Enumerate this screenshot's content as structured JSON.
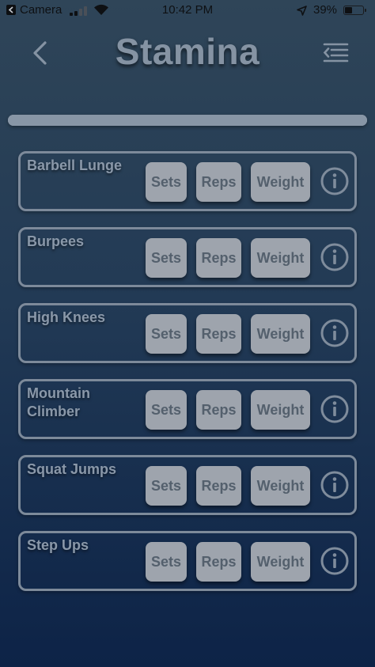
{
  "status_bar": {
    "carrier": "Camera",
    "time": "10:42 PM",
    "battery_percent": "39%",
    "battery_level": 0.39
  },
  "header": {
    "title": "Stamina",
    "back_icon": "chevron-left-icon",
    "menu_icon": "menu-list-icon"
  },
  "progress": {
    "value": 1.0
  },
  "exercises": [
    {
      "name": "Barbell Lunge",
      "sets_label": "Sets",
      "reps_label": "Reps",
      "weight_label": "Weight"
    },
    {
      "name": "Burpees",
      "sets_label": "Sets",
      "reps_label": "Reps",
      "weight_label": "Weight"
    },
    {
      "name": "High Knees",
      "sets_label": "Sets",
      "reps_label": "Reps",
      "weight_label": "Weight"
    },
    {
      "name": "Mountain Climber",
      "sets_label": "Sets",
      "reps_label": "Reps",
      "weight_label": "Weight"
    },
    {
      "name": "Squat Jumps",
      "sets_label": "Sets",
      "reps_label": "Reps",
      "weight_label": "Weight"
    },
    {
      "name": "Step Ups",
      "sets_label": "Sets",
      "reps_label": "Reps",
      "weight_label": "Weight"
    }
  ],
  "colors": {
    "accent": "#8593a3",
    "pill_background": "#9ea4ad",
    "pill_text": "#54606d",
    "background_top": "#2f4558",
    "background_bottom": "#0d2347"
  }
}
